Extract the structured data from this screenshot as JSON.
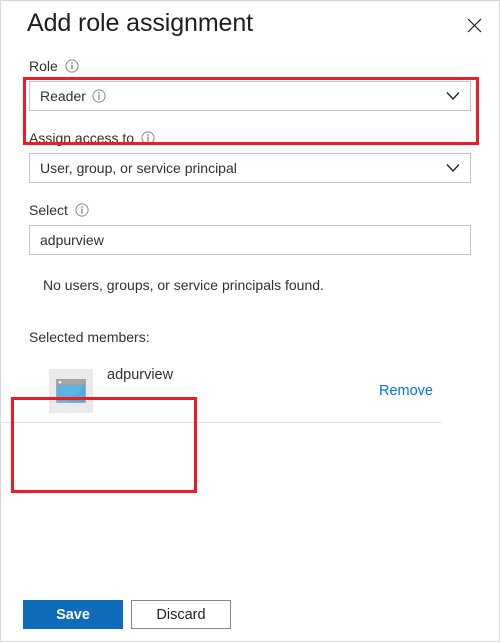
{
  "header": {
    "title": "Add role assignment",
    "close_label": "Close"
  },
  "form": {
    "role": {
      "label": "Role",
      "value": "Reader"
    },
    "assign_access_to": {
      "label": "Assign access to",
      "value": "User, group, or service principal"
    },
    "select": {
      "label": "Select",
      "value": "adpurview",
      "placeholder": "Select",
      "empty_message": "No users, groups, or service principals found."
    },
    "selected_members": {
      "label": "Selected members:",
      "members": [
        {
          "name": "adpurview",
          "remove_label": "Remove"
        }
      ]
    }
  },
  "footer": {
    "save_label": "Save",
    "discard_label": "Discard"
  },
  "colors": {
    "primary": "#0f6cbd",
    "link": "#0078d4",
    "annotation": "#ed1c24",
    "avatar_background": "#eaeaea",
    "avatar_window_body": "#5cb3e4",
    "avatar_window_titlebar": "#a6a6a6",
    "text": "#201f1e",
    "border": "#c8c6c4"
  }
}
